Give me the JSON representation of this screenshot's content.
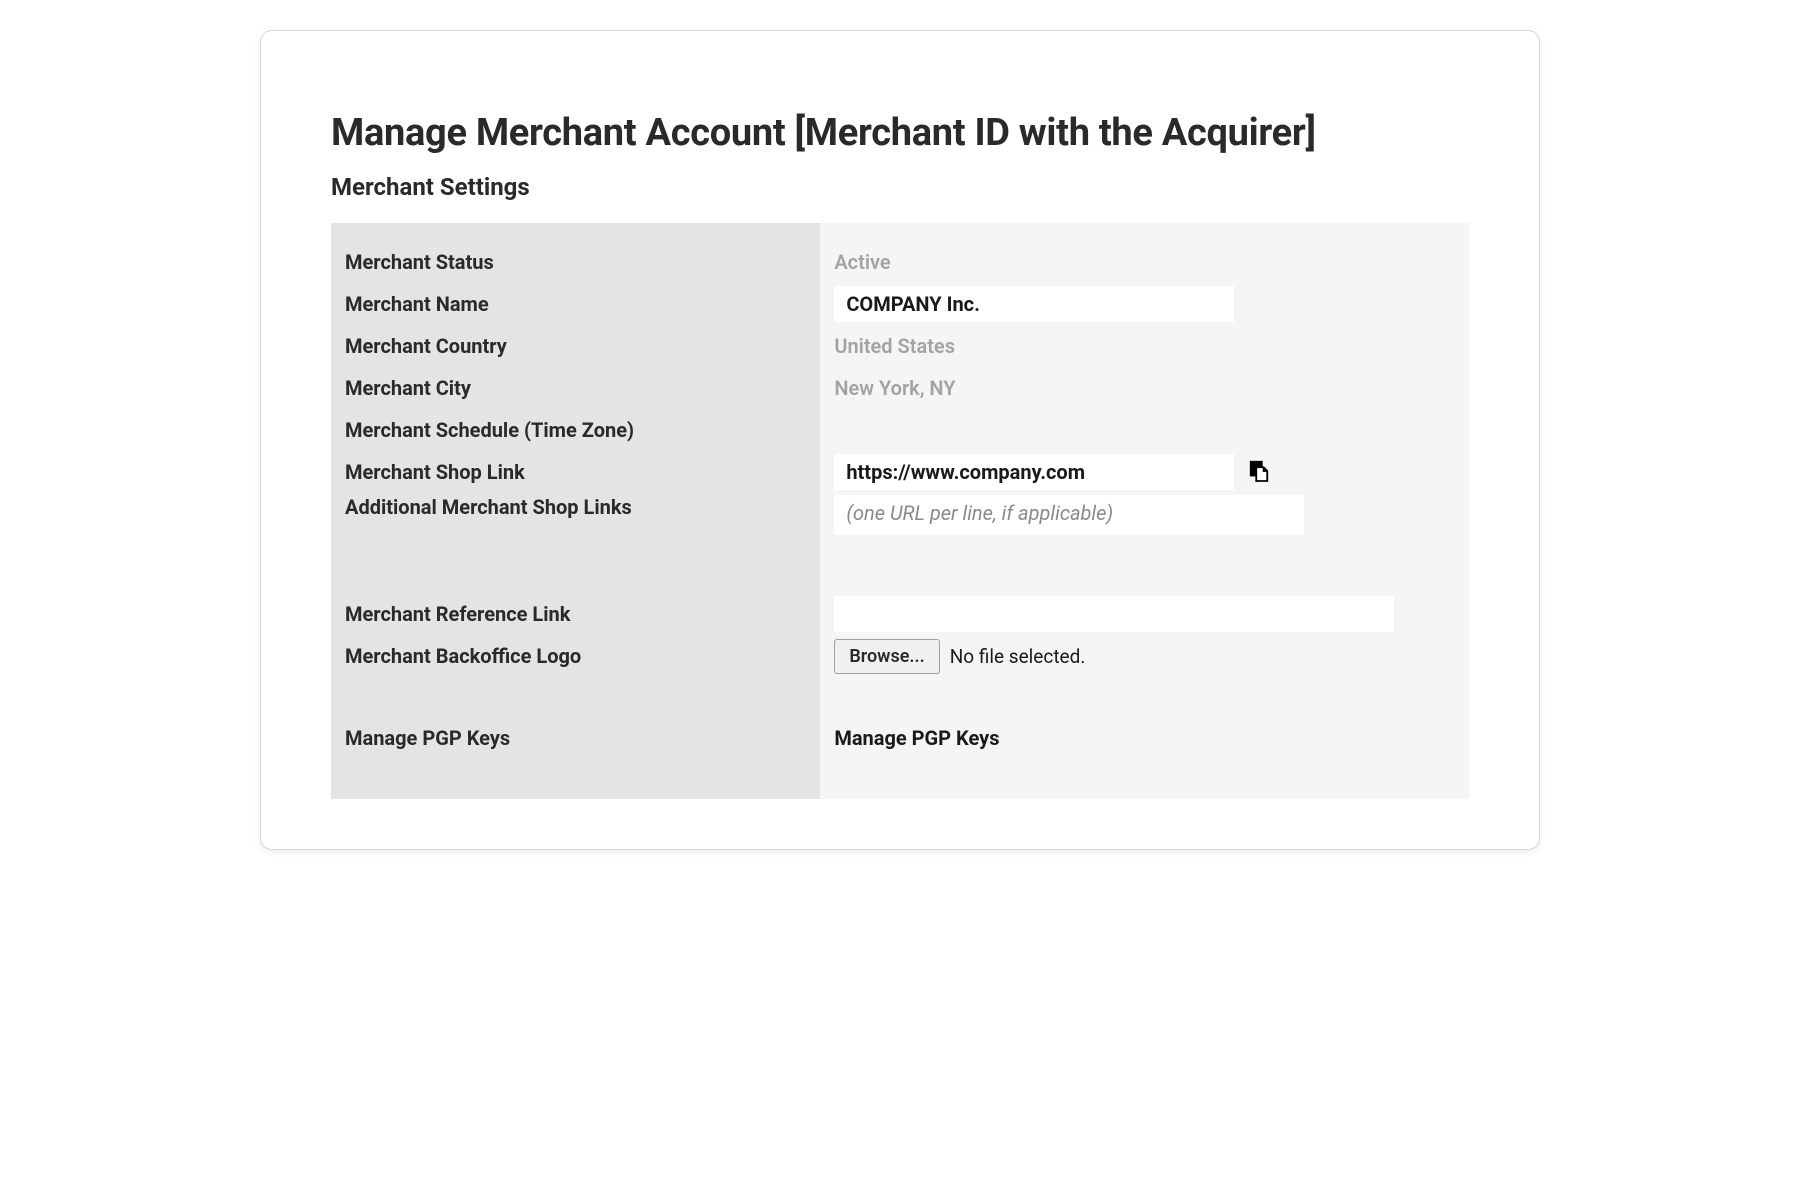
{
  "page": {
    "title": "Manage Merchant Account [Merchant ID with the Acquirer]",
    "section_title": "Merchant Settings"
  },
  "labels": {
    "merchant_status": "Merchant Status",
    "merchant_name": "Merchant Name",
    "merchant_country": "Merchant Country",
    "merchant_city": "Merchant City",
    "merchant_schedule": "Merchant Schedule (Time Zone)",
    "merchant_shop_link": "Merchant Shop Link",
    "additional_links": "Additional Merchant Shop Links",
    "merchant_reference_link": "Merchant Reference Link",
    "merchant_backoffice_logo": "Merchant Backoffice Logo",
    "manage_pgp_keys": "Manage PGP Keys"
  },
  "values": {
    "merchant_status": "Active",
    "merchant_name": "COMPANY Inc.",
    "merchant_country": "United States",
    "merchant_city": "New York, NY",
    "merchant_schedule": "",
    "merchant_shop_link": "https://www.company.com",
    "additional_links_placeholder": "(one URL per line, if applicable)",
    "merchant_reference_link": "",
    "browse_button": "Browse...",
    "file_status": "No file selected.",
    "manage_pgp_keys_link": "Manage PGP Keys"
  }
}
